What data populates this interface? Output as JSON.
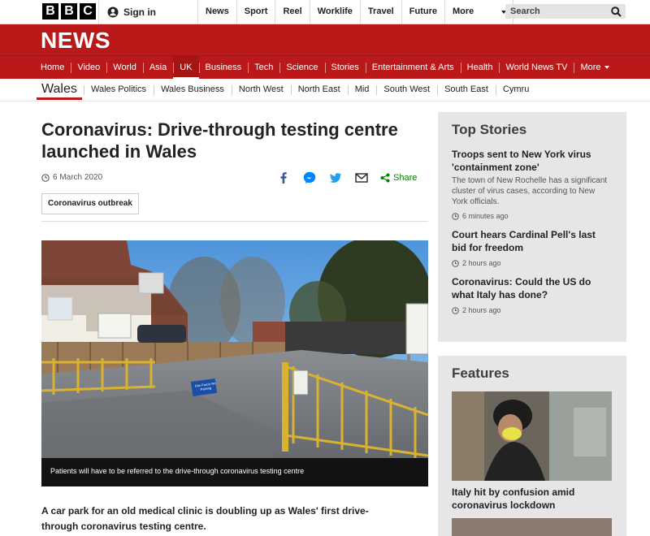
{
  "masthead": {
    "logo_letters": [
      "B",
      "B",
      "C"
    ],
    "signin_label": "Sign in",
    "nav": [
      "News",
      "Sport",
      "Reel",
      "Worklife",
      "Travel",
      "Future"
    ],
    "more_label": "More",
    "search_placeholder": "Search"
  },
  "news_bar": {
    "wordmark": "NEWS",
    "brand_color": "#bb1919",
    "sections": [
      "Home",
      "Video",
      "World",
      "Asia",
      "UK",
      "Business",
      "Tech",
      "Science",
      "Stories",
      "Entertainment & Arts",
      "Health",
      "World News TV"
    ],
    "active_section": "UK",
    "more_label": "More"
  },
  "subnav": {
    "current": "Wales",
    "items": [
      "Wales Politics",
      "Wales Business",
      "North West",
      "North East",
      "Mid",
      "South West",
      "South East",
      "Cymru"
    ]
  },
  "article": {
    "headline": "Coronavirus: Drive-through testing centre launched in Wales",
    "date": "6 March 2020",
    "share_label": "Share",
    "share_icons": [
      "facebook-icon",
      "messenger-icon",
      "twitter-icon",
      "email-icon",
      "share-icon"
    ],
    "tag": "Coronavirus outbreak",
    "caption": "Patients will have to be referred to the drive-through coronavirus testing centre",
    "sign_text": "Dim Parcio No Parking",
    "lede": "A car park for an old medical clinic is doubling up as Wales' first drive-through coronavirus testing centre."
  },
  "top_stories": {
    "title": "Top Stories",
    "items": [
      {
        "title": "Troops sent to New York virus 'containment zone'",
        "summary": "The town of New Rochelle has a significant cluster of virus cases, according to New York officials.",
        "ago": "6 minutes ago"
      },
      {
        "title": "Court hears Cardinal Pell's last bid for freedom",
        "summary": "",
        "ago": "2 hours ago"
      },
      {
        "title": "Coronavirus: Could the US do what Italy has done?",
        "summary": "",
        "ago": "2 hours ago"
      }
    ]
  },
  "features": {
    "title": "Features",
    "items": [
      {
        "title": "Italy hit by confusion amid coronavirus lockdown"
      }
    ]
  }
}
